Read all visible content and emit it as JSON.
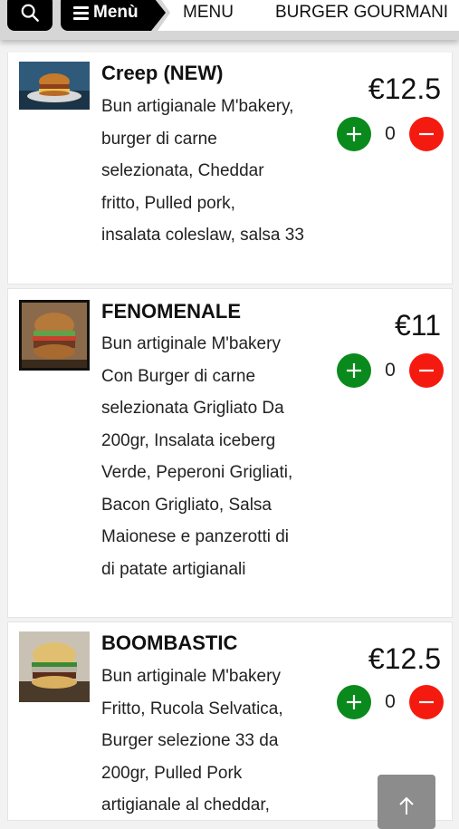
{
  "nav": {
    "menu_label": "Menù",
    "breadcrumbs": [
      "MENU",
      "BURGER GOURMANI"
    ]
  },
  "products": [
    {
      "title": "Creep (NEW)",
      "description": [
        "Bun artigianale M'bakery,",
        "burger di carne",
        "selezionata, Cheddar",
        "fritto, Pulled pork,",
        "insalata coleslaw, salsa 33"
      ],
      "price": "€12.5",
      "quantity": "0"
    },
    {
      "title": "FENOMENALE",
      "description": [
        "Bun artiginale M'bakery",
        "Con Burger di carne",
        "selezionata Grigliato Da",
        "200gr, Insalata iceberg",
        "Verde, Peperoni Grigliati,",
        "Bacon Grigliato, Salsa",
        "Maionese e panzerotti di",
        "di patate artigianali"
      ],
      "price": "€11",
      "quantity": "0"
    },
    {
      "title": "BOOMBASTIC",
      "description": [
        "Bun artiginale M'bakery",
        "Fritto, Rucola Selvatica,",
        "Burger selezione 33 da",
        "200gr, Pulled Pork",
        "artigianale al cheddar,"
      ],
      "price": "€12.5",
      "quantity": "0"
    }
  ],
  "colors": {
    "add": "#0a8a1c",
    "remove": "#f51a0f",
    "nav_dark": "#000000",
    "scroll_top": "#8c8c8c"
  },
  "icons": [
    "search-icon",
    "hamburger-icon",
    "plus-icon",
    "minus-icon",
    "arrow-up-icon"
  ]
}
